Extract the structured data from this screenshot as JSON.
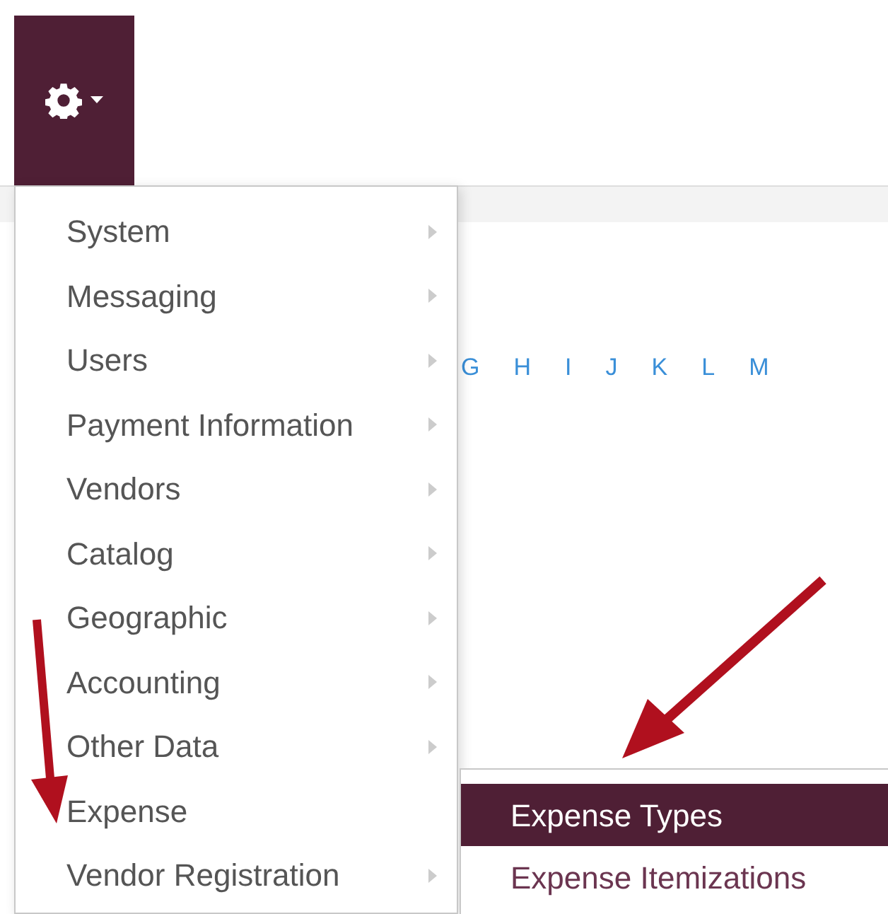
{
  "settings_button": {
    "expanded": true
  },
  "alphabet": [
    "G",
    "H",
    "I",
    "J",
    "K",
    "L",
    "M"
  ],
  "menu": [
    {
      "label": "System",
      "expanded": false
    },
    {
      "label": "Messaging",
      "expanded": false
    },
    {
      "label": "Users",
      "expanded": false
    },
    {
      "label": "Payment Information",
      "expanded": false
    },
    {
      "label": "Vendors",
      "expanded": false
    },
    {
      "label": "Catalog",
      "expanded": false
    },
    {
      "label": "Geographic",
      "expanded": false
    },
    {
      "label": "Accounting",
      "expanded": false
    },
    {
      "label": "Other Data",
      "expanded": false
    },
    {
      "label": "Expense",
      "expanded": true
    },
    {
      "label": "Vendor Registration",
      "expanded": false
    }
  ],
  "submenu": [
    {
      "label": "Expense Types",
      "selected": true
    },
    {
      "label": "Expense Itemizations",
      "selected": false
    }
  ]
}
